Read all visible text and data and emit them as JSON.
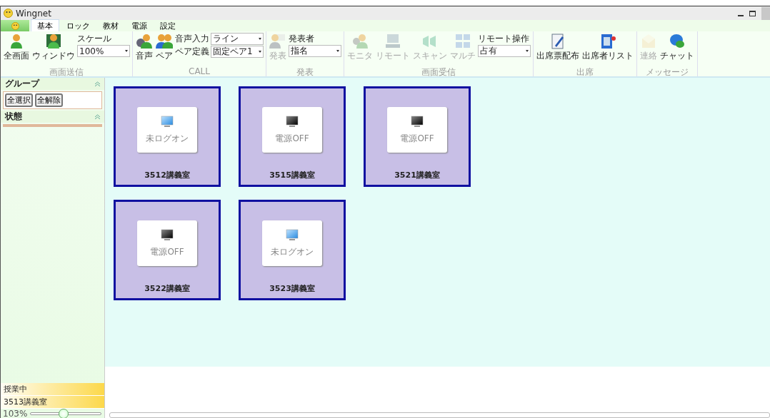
{
  "window": {
    "title": "Wingnet"
  },
  "tabs": [
    {
      "label": "基本",
      "selected": true
    },
    {
      "label": "ロック",
      "selected": false
    },
    {
      "label": "教材",
      "selected": false
    },
    {
      "label": "電源",
      "selected": false
    },
    {
      "label": "設定",
      "selected": false
    }
  ],
  "ribbon": {
    "groups": [
      {
        "label": "画面送信",
        "items": [
          {
            "kind": "button",
            "label": "全画面",
            "disabled": false
          },
          {
            "kind": "button",
            "label": "ウィンドウ",
            "disabled": false
          },
          {
            "kind": "selects",
            "fields": [
              {
                "label": "スケール",
                "value": "100%"
              }
            ]
          }
        ]
      },
      {
        "label": "CALL",
        "items": [
          {
            "kind": "button",
            "label": "音声",
            "disabled": false
          },
          {
            "kind": "button",
            "label": "ペア",
            "disabled": false
          },
          {
            "kind": "selects",
            "fields": [
              {
                "label": "音声入力",
                "value": "ライン"
              },
              {
                "label": "ペア定義",
                "value": "固定ペア1"
              }
            ]
          }
        ]
      },
      {
        "label": "発表",
        "items": [
          {
            "kind": "button",
            "label": "発表",
            "disabled": true
          },
          {
            "kind": "selects",
            "fields": [
              {
                "label": "発表者",
                "value": "指名"
              }
            ]
          }
        ]
      },
      {
        "label": "画面受信",
        "items": [
          {
            "kind": "button",
            "label": "モニタ",
            "disabled": true
          },
          {
            "kind": "button",
            "label": "リモート",
            "disabled": true
          },
          {
            "kind": "button",
            "label": "スキャン",
            "disabled": true
          },
          {
            "kind": "button",
            "label": "マルチ",
            "disabled": true
          },
          {
            "kind": "selects",
            "fields": [
              {
                "label": "リモート操作",
                "value": "占有"
              }
            ]
          }
        ]
      },
      {
        "label": "出席",
        "items": [
          {
            "kind": "button",
            "label": "出席票配布",
            "disabled": false
          },
          {
            "kind": "button",
            "label": "出席者リスト",
            "disabled": false
          }
        ]
      },
      {
        "label": "メッセージ",
        "items": [
          {
            "kind": "button",
            "label": "連絡",
            "disabled": true
          },
          {
            "kind": "button",
            "label": "チャット",
            "disabled": false
          }
        ]
      }
    ]
  },
  "sidebar": {
    "panels": [
      {
        "title": "グループ",
        "expanded": true,
        "buttons": [
          "全選択",
          "全解除"
        ]
      },
      {
        "title": "状態",
        "expanded": true
      }
    ],
    "status": [
      "授業中",
      "3513講義室"
    ],
    "zoom": {
      "reading": "103%",
      "level": 0.46
    }
  },
  "rooms": [
    {
      "name": "3512講義室",
      "status": "未ログオン",
      "kind": "logged_off"
    },
    {
      "name": "3515講義室",
      "status": "電源OFF",
      "kind": "power_off"
    },
    {
      "name": "3521講義室",
      "status": "電源OFF",
      "kind": "power_off"
    },
    {
      "name": "3522講義室",
      "status": "電源OFF",
      "kind": "power_off"
    },
    {
      "name": "3523講義室",
      "status": "未ログオン",
      "kind": "logged_off"
    }
  ]
}
